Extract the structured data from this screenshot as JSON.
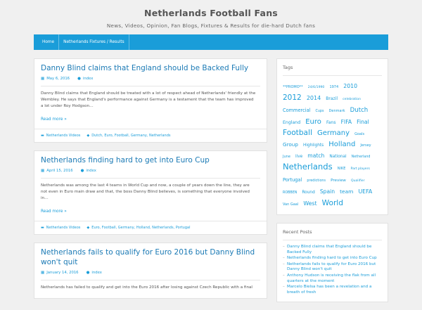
{
  "site": {
    "title": "Netherlands Football Fans",
    "description": "News, Videos, Opinion, Fan Blogs, Fixtures & Results for die-hard Dutch fans"
  },
  "nav": {
    "items": [
      "Home",
      "Netherlands Fixtures / Results"
    ]
  },
  "posts": [
    {
      "title": "Danny Blind claims that England should be Backed Fully",
      "date": "May 6, 2016",
      "author": "index",
      "excerpt": "Danny Blind claims that England should be treated with a lot of respect ahead of Netherlands' friendly at the Wembley. He says that England's performance against Germany is a testament that the team has improved a lot under Roy Hodgson…",
      "read_more": "Read more »",
      "category": "Netherlands Videos",
      "tags": "Dutch, Euro, Football, Germany, Netherlands"
    },
    {
      "title": "Netherlands finding hard to get into Euro Cup",
      "date": "April 15, 2016",
      "author": "index",
      "excerpt": "Netherlands was among the last 4 teams in World Cup and now, a couple of years down the line, they are not even in Euro main draw and that, the boss Danny Blind believes, is something that everyone involved in…",
      "read_more": "Read more »",
      "category": "Netherlands Videos",
      "tags": "Euro, Football, Germany, Holland, Netherlands, Portugal"
    },
    {
      "title": "Netherlands fails to qualify for Euro 2016 but Danny Blind won't quit",
      "date": "January 14, 2016",
      "author": "index",
      "excerpt": "Netherlands has failed to qualify and get into the Euro 2016 after losing against Czech Republic with a final",
      "read_more": "",
      "category": "",
      "tags": ""
    }
  ],
  "sidebar": {
    "tags_title": "Tags",
    "tags": [
      {
        "t": "**PROMO**",
        "s": 5
      },
      {
        "t": "24/6/1990",
        "s": 4.6
      },
      {
        "t": "1974",
        "s": 5
      },
      {
        "t": "2010",
        "s": 7.8
      },
      {
        "t": "2012",
        "s": 10.5
      },
      {
        "t": "2014",
        "s": 8
      },
      {
        "t": "Brazil",
        "s": 6
      },
      {
        "t": "celebration",
        "s": 4.6
      },
      {
        "t": "Commercial",
        "s": 6.6
      },
      {
        "t": "Cups",
        "s": 4.8
      },
      {
        "t": "Denmark",
        "s": 5
      },
      {
        "t": "Dutch",
        "s": 8.6
      },
      {
        "t": "England",
        "s": 6.2
      },
      {
        "t": "Euro",
        "s": 10
      },
      {
        "t": "Fans",
        "s": 6
      },
      {
        "t": "FIFA",
        "s": 7.6
      },
      {
        "t": "Final",
        "s": 7.6
      },
      {
        "t": "Football",
        "s": 10.6
      },
      {
        "t": "Germany",
        "s": 10
      },
      {
        "t": "Goals",
        "s": 5
      },
      {
        "t": "Group",
        "s": 7.2
      },
      {
        "t": "Highlights",
        "s": 5.8
      },
      {
        "t": "Holland",
        "s": 10
      },
      {
        "t": "Jersey",
        "s": 5
      },
      {
        "t": "June",
        "s": 5
      },
      {
        "t": "live",
        "s": 5.8
      },
      {
        "t": "match",
        "s": 7.6
      },
      {
        "t": "National",
        "s": 5.8
      },
      {
        "t": "Netherland",
        "s": 4.8
      },
      {
        "t": "Netherlands",
        "s": 11.6
      },
      {
        "t": "NIKE",
        "s": 5
      },
      {
        "t": "Part players",
        "s": 4.6
      },
      {
        "t": "Portugal",
        "s": 6.6
      },
      {
        "t": "predictions",
        "s": 4.8
      },
      {
        "t": "Preview",
        "s": 5.6
      },
      {
        "t": "Qualifier",
        "s": 4.6
      },
      {
        "t": "ROBBEN",
        "s": 4.8
      },
      {
        "t": "Round",
        "s": 5.8
      },
      {
        "t": "Spain",
        "s": 7.6
      },
      {
        "t": "team",
        "s": 7.4
      },
      {
        "t": "UEFA",
        "s": 7.8
      },
      {
        "t": "Van Gaal",
        "s": 5
      },
      {
        "t": "West",
        "s": 7.8
      },
      {
        "t": "World",
        "s": 10.6
      }
    ],
    "recent_title": "Recent Posts",
    "recent": [
      "Danny Blind claims that England should be Backed Fully",
      "Netherlands finding hard to get into Euro Cup",
      "Netherlands fails to qualify for Euro 2016 but Danny Blind won't quit",
      "Anthony Hudson is receiving the flak from all quarters at the moment",
      "Marcelo Bielsa has been a revelation and a breath of fresh"
    ]
  },
  "colors": {
    "accent": "#1a9dd9",
    "title_link": "#1b7ab5",
    "background": "#f0f0f0"
  }
}
